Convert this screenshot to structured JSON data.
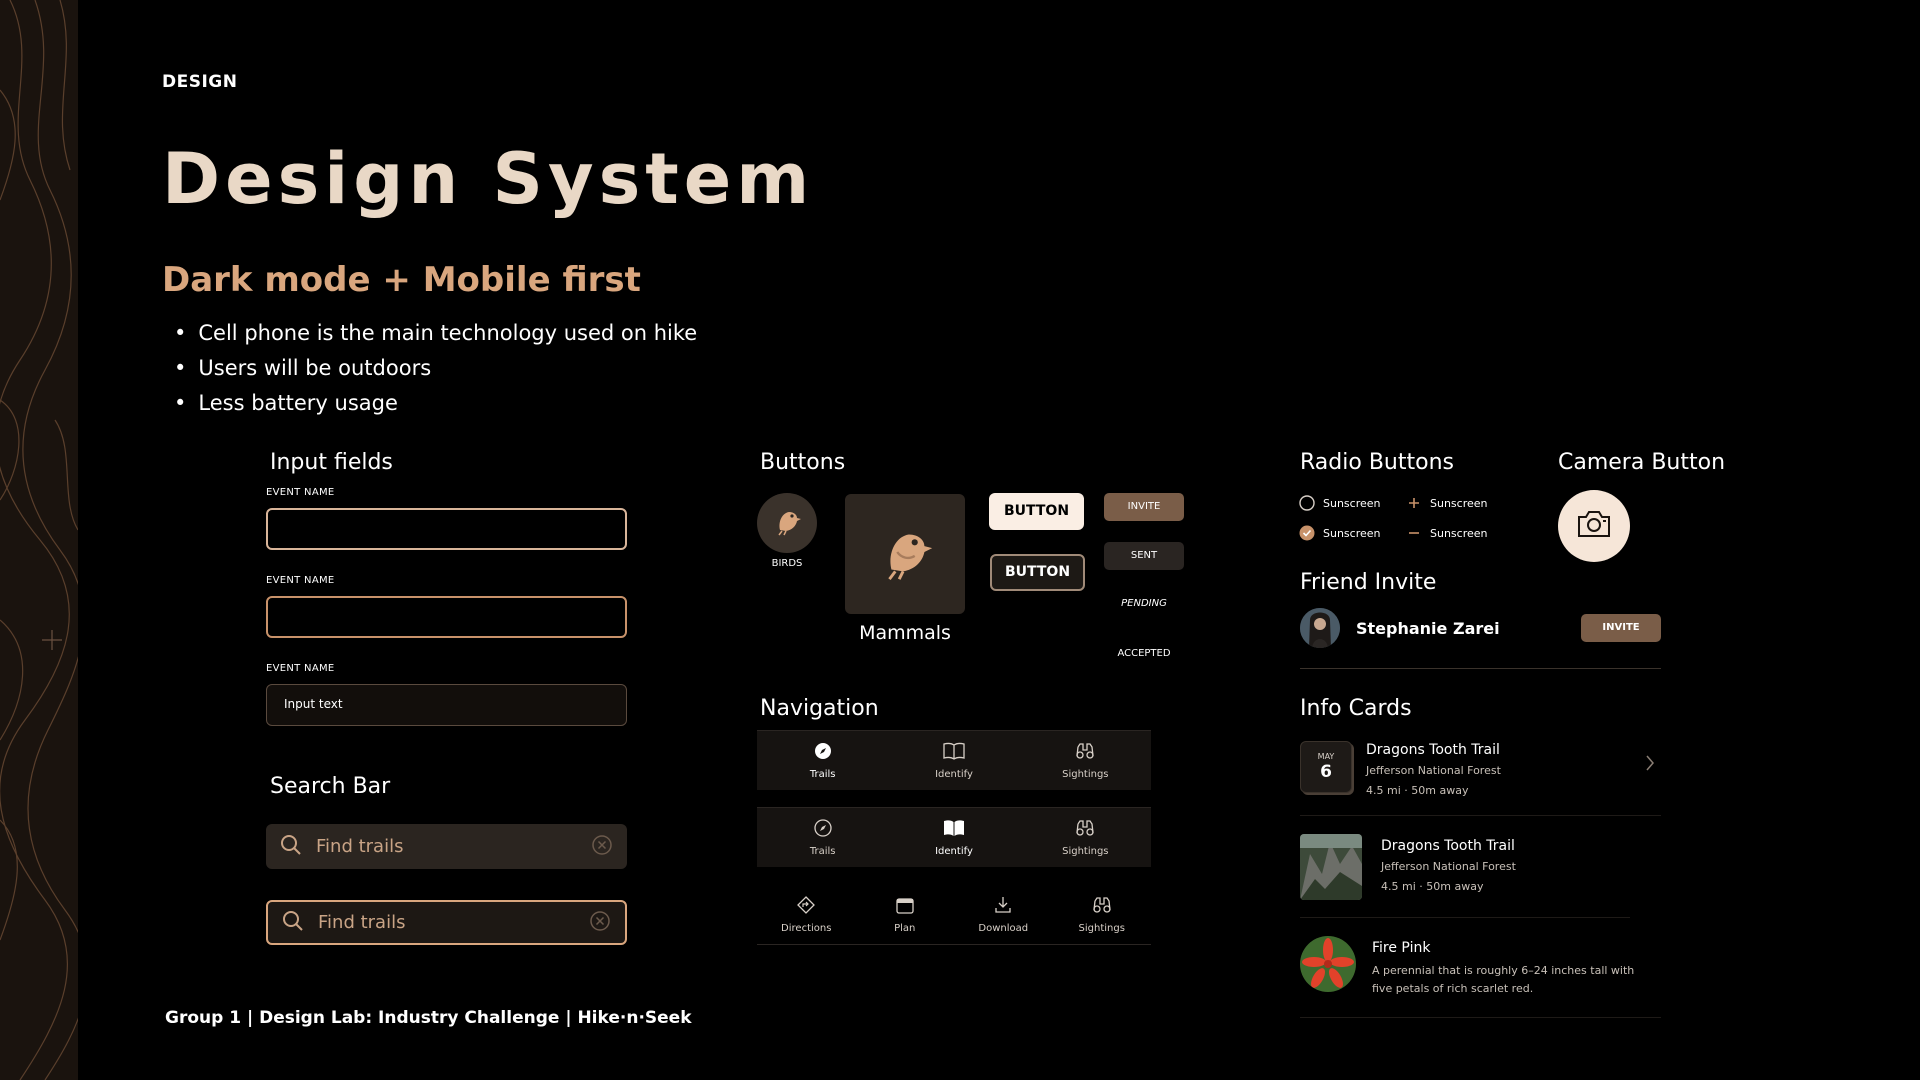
{
  "header": {
    "eyebrow": "DESIGN",
    "title": "Design System",
    "subtitle": "Dark mode + Mobile first",
    "bullets": [
      "Cell phone is the main technology used on hike",
      "Users will be outdoors",
      "Less battery usage"
    ]
  },
  "inputs": {
    "heading": "Input fields",
    "fields": [
      {
        "label": "EVENT NAME",
        "value": ""
      },
      {
        "label": "EVENT NAME",
        "value": ""
      },
      {
        "label": "EVENT NAME",
        "value": "Input text"
      }
    ]
  },
  "search": {
    "heading": "Search Bar",
    "bars": [
      {
        "placeholder": "Find trails"
      },
      {
        "placeholder": "Find trails"
      }
    ]
  },
  "buttons": {
    "heading": "Buttons",
    "circle_label": "BIRDS",
    "tile_label": "Mammals",
    "primary_label": "BUTTON",
    "secondary_label": "BUTTON",
    "chips": [
      "INVITE",
      "SENT",
      "PENDING",
      "ACCEPTED"
    ]
  },
  "navigation": {
    "heading": "Navigation",
    "bars": [
      [
        {
          "label": "Trails",
          "icon": "compass-icon",
          "active": true
        },
        {
          "label": "Identify",
          "icon": "book-icon"
        },
        {
          "label": "Sightings",
          "icon": "binoculars-icon"
        }
      ],
      [
        {
          "label": "Trails",
          "icon": "compass-icon"
        },
        {
          "label": "Identify",
          "icon": "book-icon",
          "active": true
        },
        {
          "label": "Sightings",
          "icon": "binoculars-icon"
        }
      ],
      [
        {
          "label": "Directions",
          "icon": "directions-icon"
        },
        {
          "label": "Plan",
          "icon": "calendar-icon"
        },
        {
          "label": "Download",
          "icon": "download-icon"
        },
        {
          "label": "Sightings",
          "icon": "binoculars-icon"
        }
      ]
    ]
  },
  "radio": {
    "heading": "Radio Buttons",
    "options": [
      "Sunscreen",
      "Sunscreen",
      "Sunscreen",
      "Sunscreen"
    ]
  },
  "camera": {
    "heading": "Camera Button"
  },
  "friend": {
    "heading": "Friend Invite",
    "name": "Stephanie Zarei",
    "button": "INVITE"
  },
  "info_cards": {
    "heading": "Info Cards",
    "cards": [
      {
        "month": "MAY",
        "day": "6",
        "title": "Dragons Tooth Trail",
        "sub": "Jefferson National Forest",
        "meta": "4.5 mi · 50m away"
      },
      {
        "title": "Dragons Tooth Trail",
        "sub": "Jefferson National Forest",
        "meta": "4.5 mi · 50m away"
      },
      {
        "title": "Fire Pink",
        "sub": "A perennial that is roughly 6–24 inches tall with five petals of rich scarlet red."
      }
    ]
  },
  "footer": "Group 1  |  Design Lab: Industry Challenge  |  Hike·n·Seek",
  "colors": {
    "accent": "#d9a67e",
    "title": "#e9d8c6",
    "invite": "#7a5d48",
    "camera": "#f6e6d8"
  }
}
